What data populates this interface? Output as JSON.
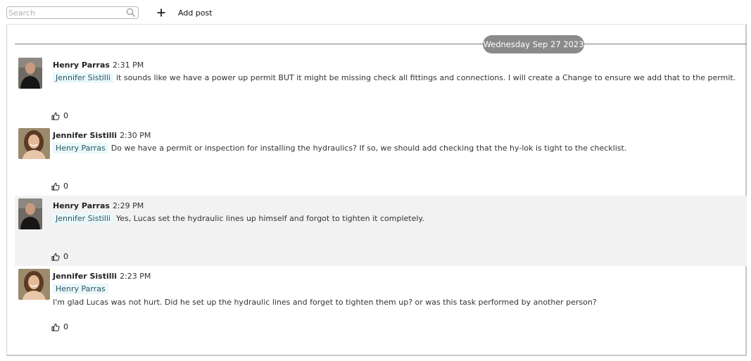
{
  "toolbar": {
    "search_placeholder": "Search",
    "search_icon": "search-icon",
    "add_post_label": "Add post",
    "add_icon": "plus-icon"
  },
  "feed": {
    "date_separator": "Wednesday Sep 27 2023",
    "posts": [
      {
        "author": "Henry Parras",
        "time": "2:31 PM",
        "mention": "Jennifer Sistilli",
        "text": "it sounds like we have a power up permit BUT it might be missing check all fittings and connections. I will create a Change to ensure we add that to the permit.",
        "likes": "0"
      },
      {
        "author": "Jennifer Sistilli",
        "time": "2:30 PM",
        "mention": "Henry Parras",
        "text": "Do we have a permit or inspection for installing the hydraulics? If so, we should add checking that the hy-lok is tight to the checklist.",
        "likes": "0"
      },
      {
        "author": "Henry Parras",
        "time": "2:29 PM",
        "mention": "Jennifer Sistilli",
        "text": "Yes, Lucas set the hydraulic lines up himself and forgot to tighten it completely.",
        "likes": "0"
      },
      {
        "author": "Jennifer Sistilli",
        "time": "2:23 PM",
        "mention": "Henry Parras",
        "text": "I'm glad Lucas was not hurt. Did he set up the hydraulic lines and forget to tighten them up? or was this task performed by another person?",
        "likes": "0"
      }
    ]
  },
  "colors": {
    "date_pill": "#8a8a8a",
    "mention_bg": "#e9f8fb",
    "highlight_row": "#f2f2f2"
  }
}
